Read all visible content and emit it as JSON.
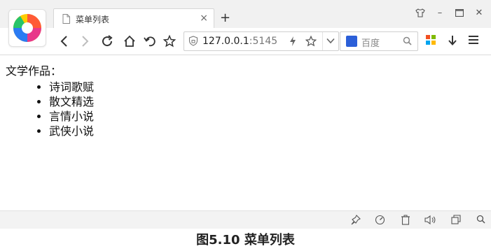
{
  "tab": {
    "title": "菜单列表",
    "close_glyph": "×"
  },
  "new_tab_glyph": "+",
  "window": {
    "minimize": "–",
    "close": "✕"
  },
  "address": {
    "url_main": "127.0.0.1",
    "url_rest": ":5145"
  },
  "search": {
    "engine_label": "百度"
  },
  "page": {
    "heading": "文学作品：",
    "items": [
      "诗词歌赋",
      "散文精选",
      "言情小说",
      "武侠小说"
    ]
  },
  "caption": "图5.10  菜单列表"
}
